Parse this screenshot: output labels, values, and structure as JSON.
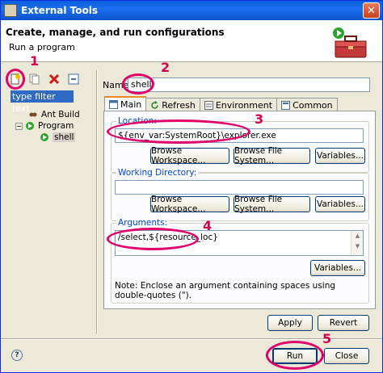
{
  "window": {
    "title": "External Tools",
    "close_glyph": "✕"
  },
  "banner": {
    "heading": "Create, manage, and run configurations",
    "subheading": "Run a program",
    "icon": "toolbox-icon"
  },
  "tree": {
    "toolbar": [
      "new-config-icon",
      "duplicate-icon",
      "delete-icon",
      "collapse-icon"
    ],
    "filter_text": "type filter text",
    "items": [
      {
        "label": "Ant Build"
      },
      {
        "label": "Program"
      },
      {
        "label": "shell"
      }
    ]
  },
  "config": {
    "name_label": "Name:",
    "name_value": "shell",
    "tabs": [
      {
        "label": "Main",
        "active": true
      },
      {
        "label": "Refresh"
      },
      {
        "label": "Environment"
      },
      {
        "label": "Common"
      }
    ],
    "location": {
      "title": "Location:",
      "value": "${env_var:SystemRoot}\\explorer.exe",
      "buttons": [
        "Browse Workspace...",
        "Browse File System...",
        "Variables..."
      ]
    },
    "working_dir": {
      "title": "Working Directory:",
      "value": "",
      "buttons": [
        "Browse Workspace...",
        "Browse File System...",
        "Variables..."
      ]
    },
    "arguments": {
      "title": "Arguments:",
      "value": "/select,${resource_loc}",
      "variables_button": "Variables...",
      "note": "Note: Enclose an argument containing spaces using double-quotes (\")."
    },
    "apply_label": "Apply",
    "revert_label": "Revert"
  },
  "footer": {
    "help_glyph": "?",
    "run_label": "Run",
    "close_label": "Close"
  },
  "callouts": {
    "one": "1",
    "two": "2",
    "three": "3",
    "four": "4",
    "five": "5",
    "color": "#d6004f"
  }
}
